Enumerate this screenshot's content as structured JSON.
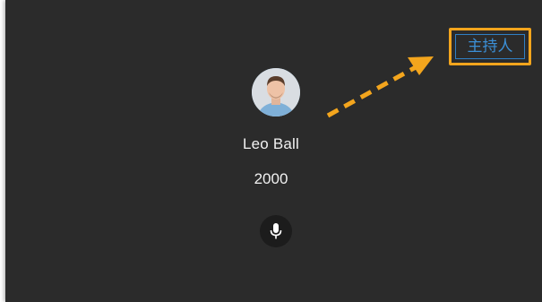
{
  "participant": {
    "name": "Leo Ball",
    "extension": "2000",
    "avatar_icon": "user-avatar-photo",
    "mic_icon": "microphone-icon"
  },
  "role_badge": {
    "label": "主持人"
  },
  "colors": {
    "background": "#2b2b2b",
    "text": "#f2f2f2",
    "badge_text": "#3b8fd6",
    "highlight": "#f3a51d"
  }
}
